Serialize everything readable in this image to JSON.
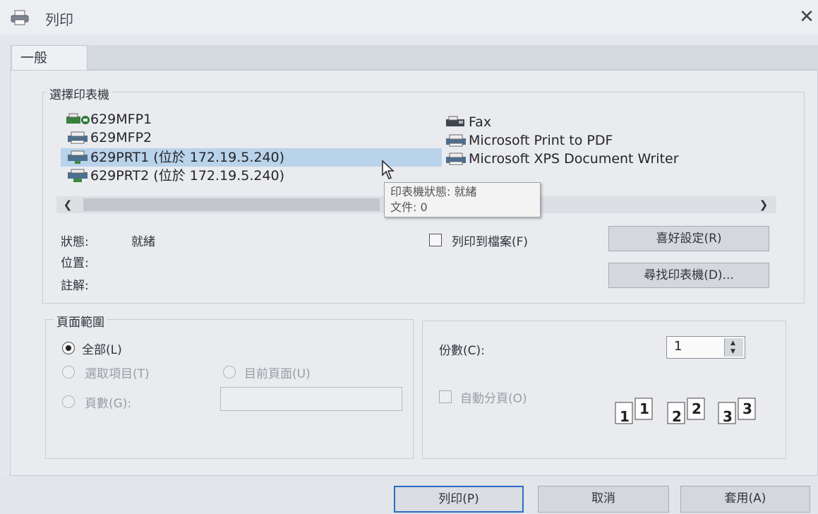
{
  "window": {
    "title": "列印",
    "close_glyph": "✕",
    "title_icon": "printer-icon"
  },
  "tabs": [
    {
      "label": "一般"
    }
  ],
  "printer_group": {
    "legend": "選擇印表機",
    "printers": [
      {
        "name": "629MFP1",
        "icon": "printer-icon"
      },
      {
        "name": "629MFP2",
        "icon": "printer-icon"
      },
      {
        "name": "629PRT1 (位於 172.19.5.240)",
        "icon": "network-printer-icon",
        "selected": true
      },
      {
        "name": "629PRT2 (位於 172.19.5.240)",
        "icon": "network-printer-icon"
      },
      {
        "name": "Fax",
        "icon": "fax-icon"
      },
      {
        "name": "Microsoft Print to PDF",
        "icon": "printer-icon"
      },
      {
        "name": "Microsoft XPS Document Writer",
        "icon": "printer-icon"
      }
    ],
    "tooltip": {
      "line1": "印表機狀態: 就緒",
      "line2": "文件: 0"
    },
    "status_label": "狀態:",
    "status_value": "就緒",
    "location_label": "位置:",
    "comment_label": "註解:",
    "print_to_file": "列印到檔案(F)",
    "preferences_button": "喜好設定(R)",
    "find_printer_button": "尋找印表機(D)..."
  },
  "page_range": {
    "legend": "頁面範圍",
    "all": "全部(L)",
    "selection": "選取項目(T)",
    "current_page": "目前頁面(U)",
    "pages": "頁數(G):",
    "selected_option": "all"
  },
  "copies": {
    "label": "份數(C):",
    "value": "1",
    "collate": "自動分頁(O)"
  },
  "footer": {
    "print_button": "列印(P)",
    "cancel_button": "取消",
    "apply_button": "套用(A)"
  },
  "colors": {
    "selection": "#b9d3ea",
    "primary_border": "#2d6cc7"
  }
}
